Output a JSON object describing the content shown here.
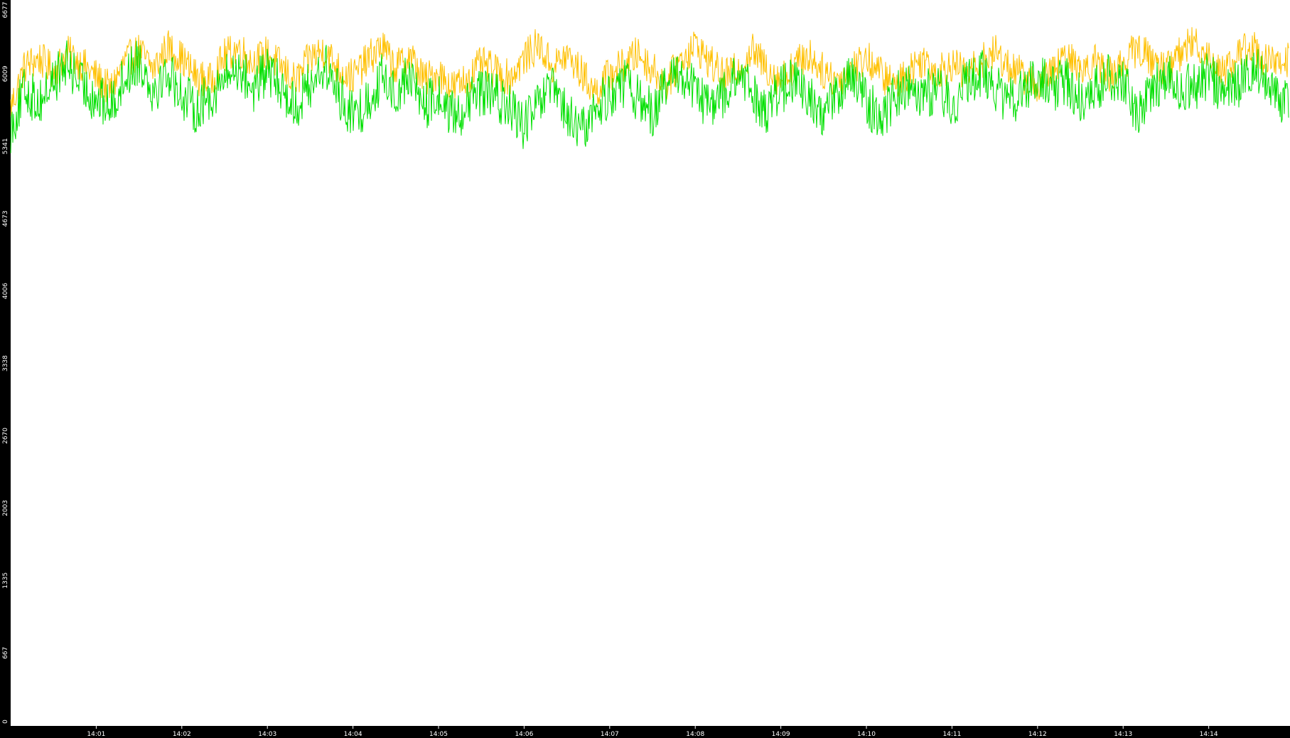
{
  "chart_data": {
    "type": "line",
    "title": "",
    "xlabel": "",
    "ylabel": "",
    "x_tick_labels": [
      "14:01",
      "14:02",
      "14:03",
      "14:04",
      "14:05",
      "14:06",
      "14:07",
      "14:08",
      "14:09",
      "14:10",
      "14:11",
      "14:12",
      "14:13",
      "14:14"
    ],
    "y_tick_labels": [
      "0",
      "667",
      "1335",
      "2003",
      "2670",
      "3338",
      "4006",
      "4673",
      "5341",
      "6009",
      "6677"
    ],
    "ylim": [
      0,
      6677
    ],
    "x_range": [
      "14:00:00",
      "14:14:56"
    ],
    "grid": false,
    "legend": "none",
    "series": [
      {
        "color": "#ffc000",
        "sample_every_seconds": 10,
        "values": [
          5700,
          6080,
          6150,
          6030,
          6200,
          6100,
          5980,
          5860,
          6120,
          6220,
          6050,
          6260,
          6150,
          5980,
          5940,
          6170,
          6250,
          6110,
          6200,
          6070,
          5930,
          6160,
          6230,
          6050,
          5980,
          6130,
          6270,
          6060,
          6180,
          5950,
          6020,
          5880,
          5960,
          6100,
          6030,
          5970,
          6150,
          6280,
          6070,
          6180,
          6020,
          5840,
          6010,
          6090,
          6200,
          6050,
          5920,
          6140,
          6280,
          6120,
          5980,
          6050,
          6220,
          6070,
          5950,
          6100,
          6180,
          6030,
          5950,
          6070,
          6160,
          6010,
          5900,
          6040,
          6150,
          6030,
          6100,
          6000,
          6120,
          6210,
          6080,
          5990,
          5890,
          6020,
          6150,
          6060,
          6130,
          6000,
          6110,
          6250,
          6140,
          6050,
          6200,
          6310,
          6180,
          6030,
          6180,
          6270,
          6130,
          6080,
          6210,
          6150,
          6000,
          6110,
          6230,
          6070,
          5950,
          6070,
          6150,
          6030
        ]
      },
      {
        "color": "#00e000",
        "sample_every_seconds": 10,
        "values": [
          5500,
          5860,
          5740,
          5950,
          6100,
          5900,
          5780,
          5700,
          5980,
          6150,
          5860,
          6030,
          5820,
          5680,
          5800,
          5960,
          6070,
          5870,
          6030,
          5880,
          5700,
          5920,
          6080,
          5830,
          5610,
          5740,
          5970,
          5830,
          5990,
          5710,
          5790,
          5620,
          5700,
          5860,
          5790,
          5690,
          5530,
          5720,
          5870,
          5620,
          5470,
          5680,
          5820,
          5920,
          5780,
          5660,
          5890,
          6030,
          5850,
          5690,
          5820,
          5990,
          5820,
          5680,
          5860,
          5960,
          5760,
          5650,
          5840,
          5960,
          5760,
          5600,
          5800,
          5940,
          5820,
          5860,
          5740,
          5900,
          6020,
          5890,
          5740,
          5830,
          5960,
          5880,
          5950,
          5780,
          5850,
          6020,
          5900,
          5680,
          5840,
          6010,
          5860,
          5890,
          6000,
          5840,
          5900,
          6080,
          5980,
          5720,
          5860,
          6000,
          5890,
          5860,
          5950,
          5810,
          5730,
          5830,
          5950,
          5830
        ]
      }
    ]
  }
}
